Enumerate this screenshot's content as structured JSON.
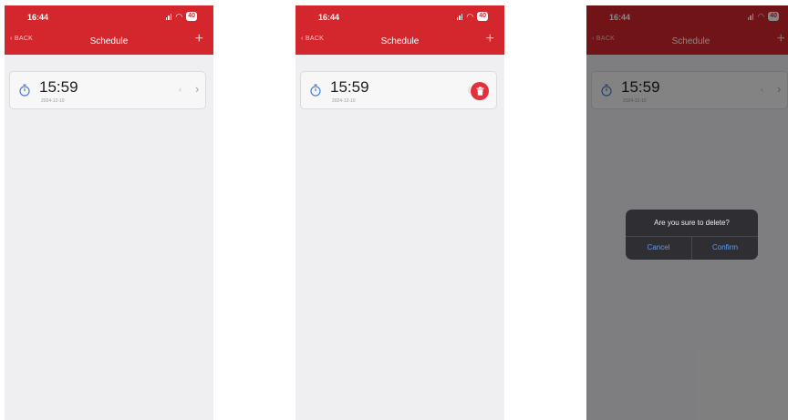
{
  "status_bar": {
    "time": "16:44",
    "battery": "40"
  },
  "nav": {
    "back_label": "BACK",
    "title": "Schedule",
    "add_symbol": "+"
  },
  "schedule_item": {
    "time": "15:59",
    "date": "2024-12-10"
  },
  "dialog": {
    "message": "Are you sure to delete?",
    "cancel_label": "Cancel",
    "confirm_label": "Confirm"
  },
  "icons": {
    "timer": "stopwatch-icon",
    "delete": "trash-icon",
    "chevron": "chevron-right-icon",
    "back": "chevron-left-icon"
  },
  "colors": {
    "accent": "#d3262d",
    "delete": "#e3303b",
    "dialog_button": "#5b9cf4",
    "background": "#efeff1"
  }
}
